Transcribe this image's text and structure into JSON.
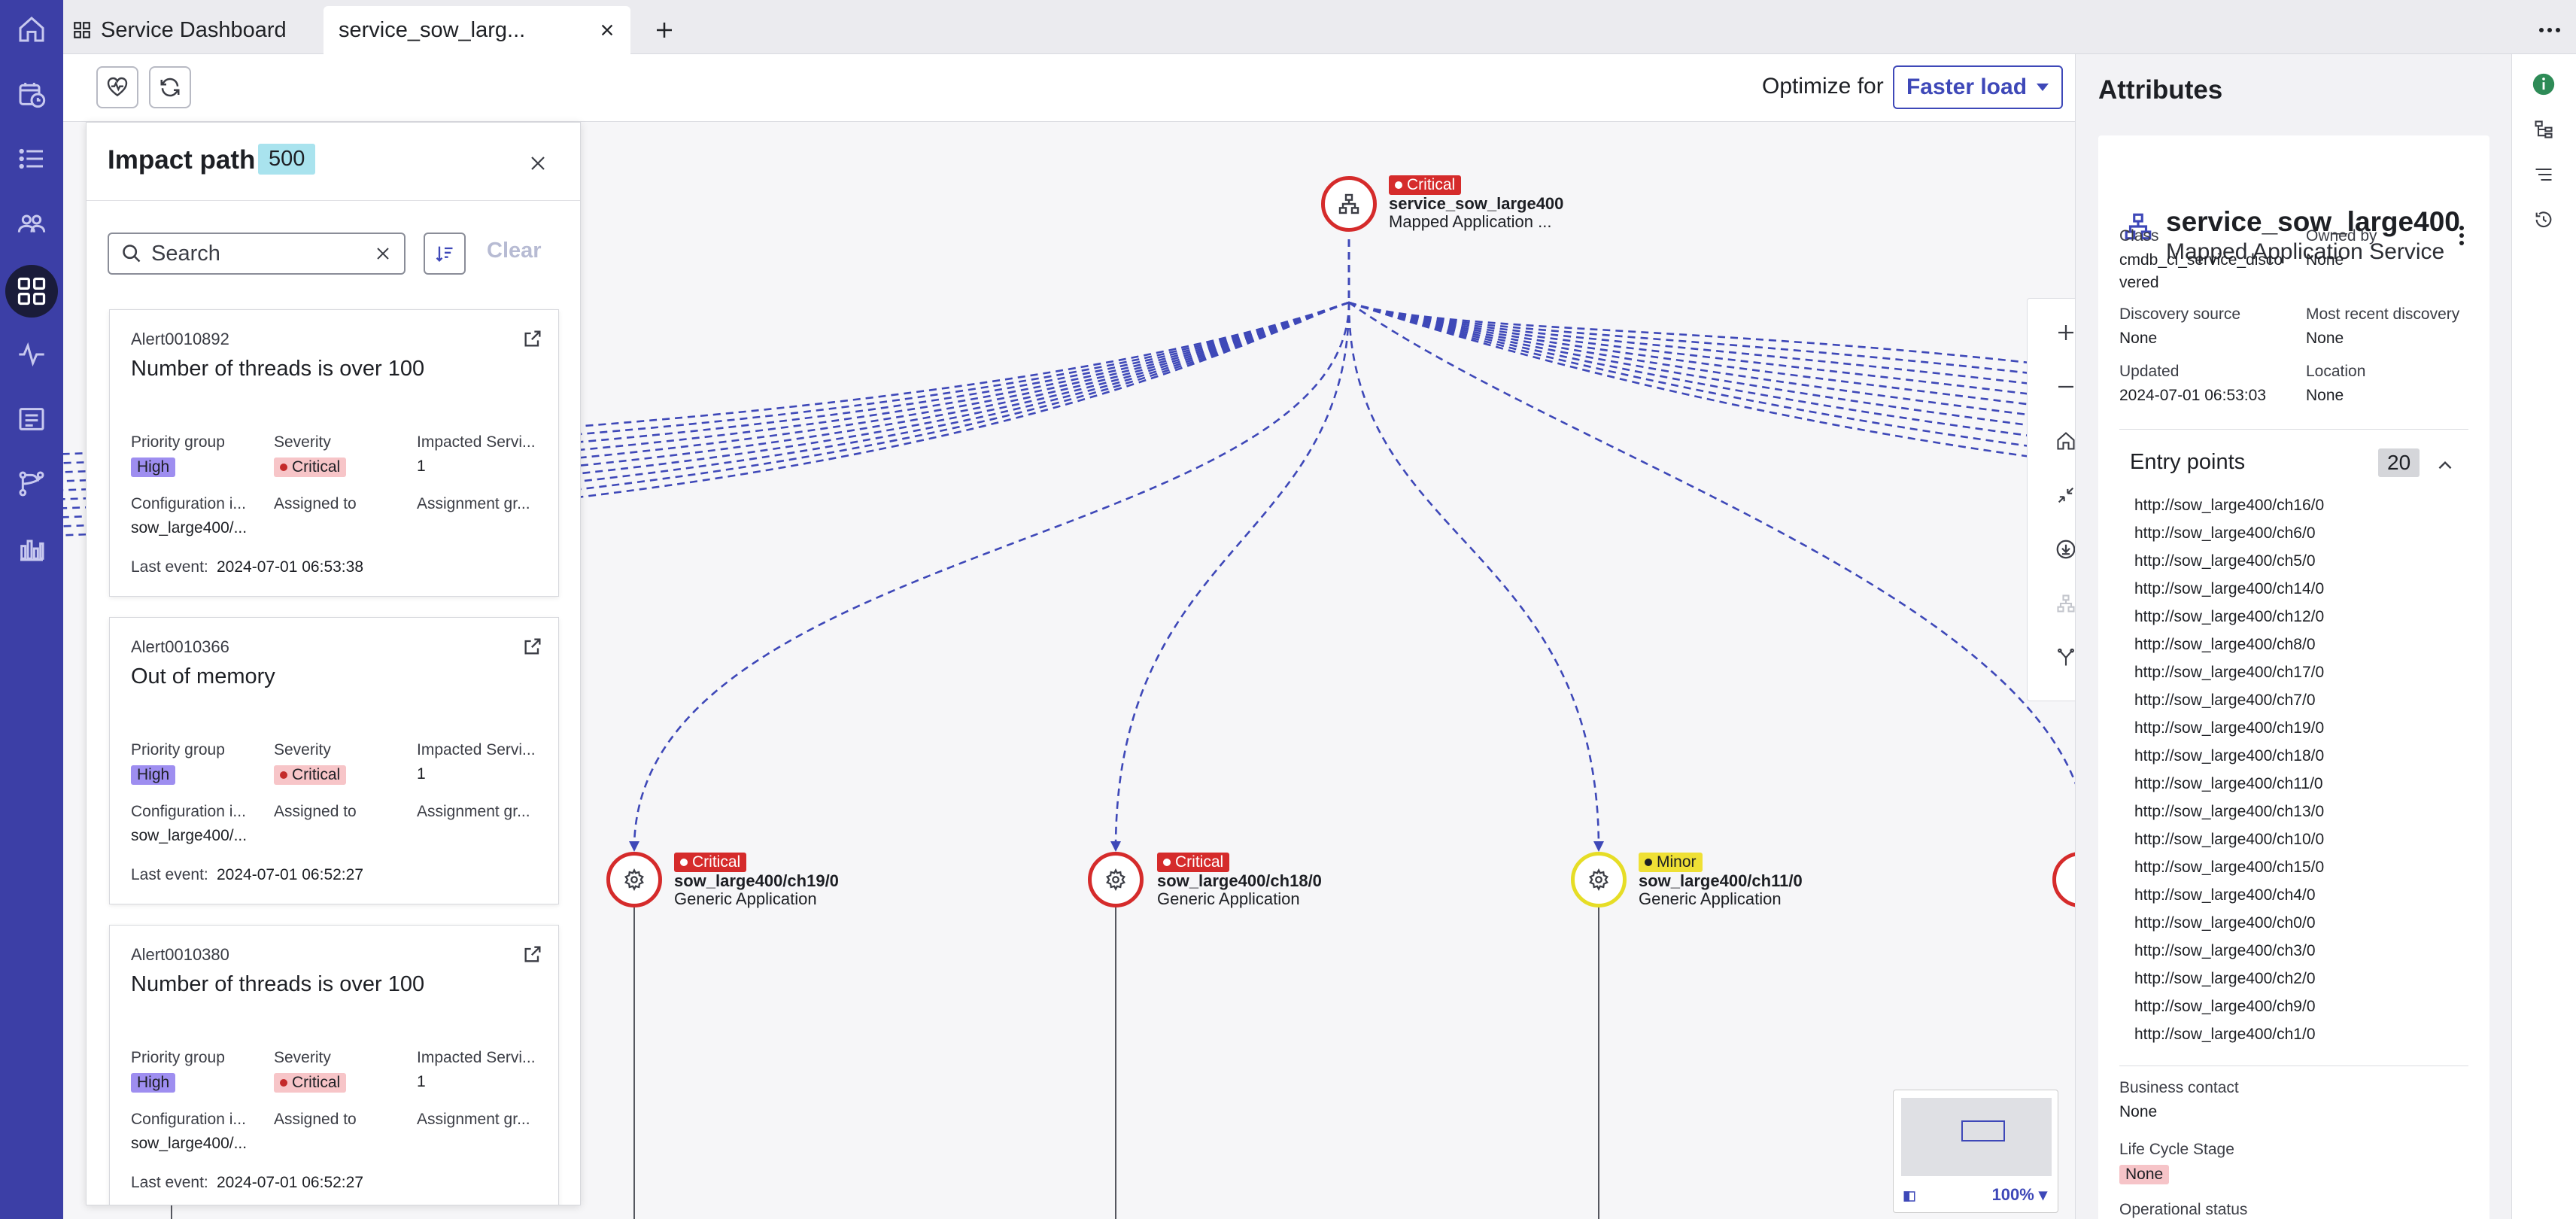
{
  "tabs": {
    "dashboard_label": "Service Dashboard",
    "active_label": "service_sow_larg...",
    "icons": [
      "home-icon",
      "apps-grid-icon",
      "close-icon",
      "plus-icon",
      "more-icon"
    ]
  },
  "leftnav": {
    "icons": [
      "home-icon",
      "calendar-clock-icon",
      "list-icon",
      "groups-icon",
      "dashboard-icon",
      "pulse-icon",
      "report-list-icon",
      "branch-icon",
      "bar-chart-icon"
    ],
    "active_index": 4
  },
  "toolbar": {
    "optimize_label": "Optimize for",
    "optimize_value": "Faster load"
  },
  "impact": {
    "title": "Impact path",
    "count": "500",
    "search_placeholder": "Search",
    "clear_label": "Clear",
    "alerts": [
      {
        "id": "Alert0010892",
        "title": "Number of threads is over 100",
        "priority_label": "Priority group",
        "priority": "High",
        "severity_label": "Severity",
        "severity": "Critical",
        "impacted_label": "Impacted Servi...",
        "impacted": "1",
        "config_label": "Configuration i...",
        "config": "sow_large400/...",
        "assigned_label": "Assigned to",
        "assigned": "",
        "group_label": "Assignment gr...",
        "last_event_label": "Last event:",
        "last_event": "2024-07-01 06:53:38"
      },
      {
        "id": "Alert0010366",
        "title": "Out of memory",
        "priority_label": "Priority group",
        "priority": "High",
        "severity_label": "Severity",
        "severity": "Critical",
        "impacted_label": "Impacted Servi...",
        "impacted": "1",
        "config_label": "Configuration i...",
        "config": "sow_large400/...",
        "assigned_label": "Assigned to",
        "assigned": "",
        "group_label": "Assignment gr...",
        "last_event_label": "Last event:",
        "last_event": "2024-07-01 06:52:27"
      },
      {
        "id": "Alert0010380",
        "title": "Number of threads is over 100",
        "priority_label": "Priority group",
        "priority": "High",
        "severity_label": "Severity",
        "severity": "Critical",
        "impacted_label": "Impacted Servi...",
        "impacted": "1",
        "config_label": "Configuration i...",
        "config": "sow_large400/...",
        "assigned_label": "Assigned to",
        "assigned": "",
        "group_label": "Assignment gr...",
        "last_event_label": "Last event:",
        "last_event": "2024-07-01 06:52:27"
      }
    ]
  },
  "graph": {
    "root": {
      "severity": "Critical",
      "name": "service_sow_large400",
      "type": "Mapped Application ..."
    },
    "children": [
      {
        "severity": "Critical",
        "name": "sow_large400/ch19/0",
        "type": "Generic Application"
      },
      {
        "severity": "Critical",
        "name": "sow_large400/ch18/0",
        "type": "Generic Application"
      },
      {
        "severity": "Minor",
        "name": "sow_large400/ch11/0",
        "type": "Generic Application"
      }
    ],
    "zoom_icons": [
      "zoom-in-icon",
      "zoom-out-icon",
      "home-icon",
      "collapse-icon",
      "download-icon",
      "hierarchy-icon",
      "fork-icon"
    ],
    "minimap_zoom": "100%"
  },
  "attributes": {
    "title": "Attributes",
    "service_name": "service_sow_large400",
    "service_type": "Mapped Application Service",
    "class_label": "Class",
    "class_value_1": "cmdb_ci_service_disco",
    "class_value_2": "vered",
    "owned_label": "Owned by",
    "owned_value": "None",
    "discovery_label": "Discovery source",
    "discovery_value": "None",
    "recent_label": "Most recent discovery",
    "recent_value": "None",
    "updated_label": "Updated",
    "updated_value": "2024-07-01 06:53:03",
    "location_label": "Location",
    "location_value": "None",
    "entry_label": "Entry points",
    "entry_count": "20",
    "entries": [
      "http://sow_large400/ch16/0",
      "http://sow_large400/ch6/0",
      "http://sow_large400/ch5/0",
      "http://sow_large400/ch14/0",
      "http://sow_large400/ch12/0",
      "http://sow_large400/ch8/0",
      "http://sow_large400/ch17/0",
      "http://sow_large400/ch7/0",
      "http://sow_large400/ch19/0",
      "http://sow_large400/ch18/0",
      "http://sow_large400/ch11/0",
      "http://sow_large400/ch13/0",
      "http://sow_large400/ch10/0",
      "http://sow_large400/ch15/0",
      "http://sow_large400/ch4/0",
      "http://sow_large400/ch0/0",
      "http://sow_large400/ch3/0",
      "http://sow_large400/ch2/0",
      "http://sow_large400/ch9/0",
      "http://sow_large400/ch1/0"
    ],
    "business_label": "Business contact",
    "business_value": "None",
    "lifecycle_label": "Life Cycle Stage",
    "lifecycle_value": "None",
    "operational_label": "Operational status"
  },
  "colors": {
    "nav_bg": "#3c3fa6",
    "accent": "#3e48b8",
    "critical": "#d52b2b",
    "minor": "#e6dd26",
    "edge": "#3e48b8"
  }
}
